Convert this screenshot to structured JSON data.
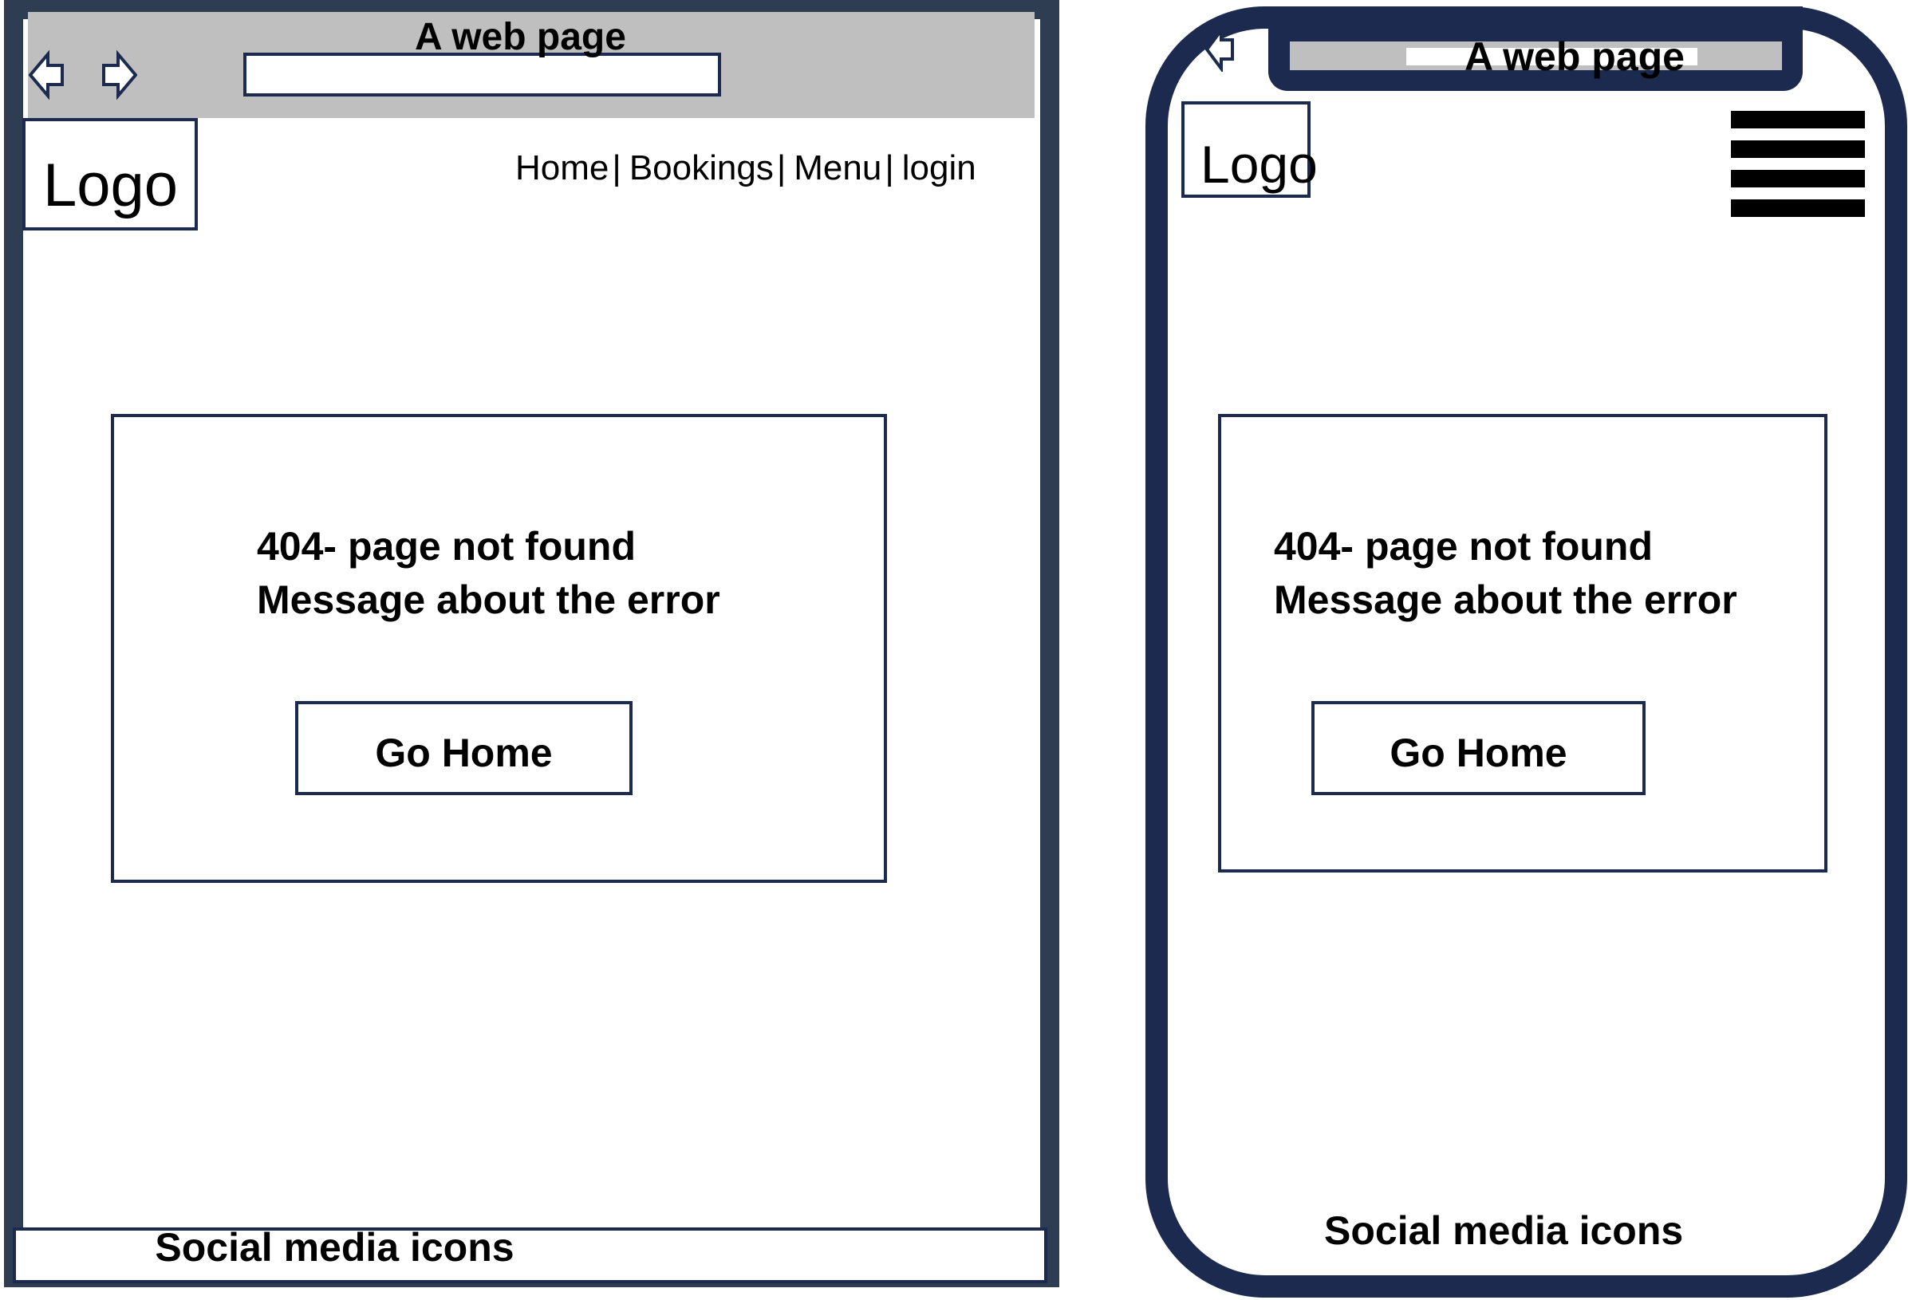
{
  "desktop": {
    "title": "A web page",
    "logo": "Logo",
    "nav": [
      {
        "label": "Home",
        "sep": "|"
      },
      {
        "label": "Bookings",
        "sep": "|"
      },
      {
        "label": "Menu",
        "sep": "|"
      },
      {
        "label": "login",
        "sep": ""
      }
    ],
    "error_title": "404- page not found",
    "error_message": "Message about the error",
    "button_label": "Go Home",
    "footer": "Social media icons"
  },
  "mobile": {
    "title": "A web page",
    "logo": "Logo",
    "error_title": "404- page not found",
    "error_message": "Message about the error",
    "button_label": "Go Home",
    "footer": "Social media icons"
  },
  "colors": {
    "frame": "#2e3d52",
    "outline": "#1b2a4e",
    "browser_bar": "#bfbfbf"
  },
  "icons": [
    "back-arrow-icon",
    "forward-arrow-icon",
    "hamburger-menu-icon"
  ]
}
